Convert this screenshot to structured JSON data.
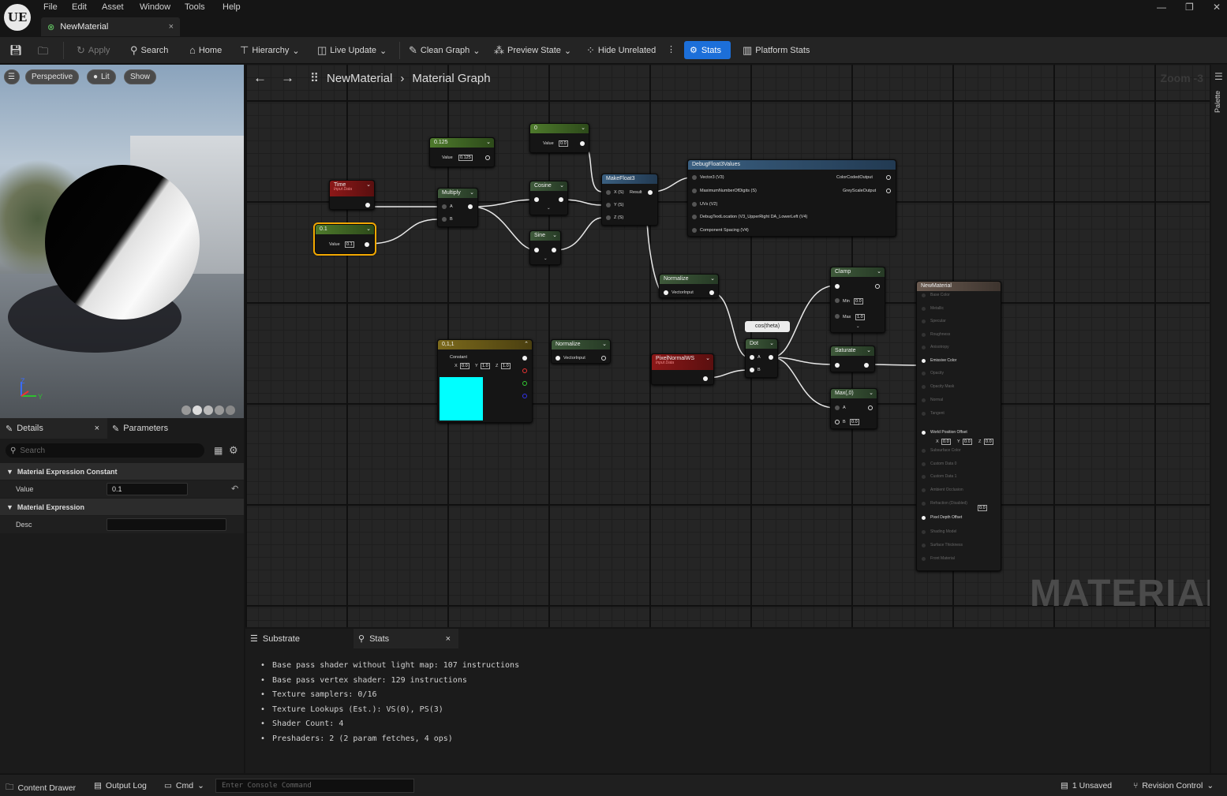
{
  "app": {
    "logo": "UE",
    "menu": [
      "File",
      "Edit",
      "Asset",
      "Window",
      "Tools",
      "Help"
    ],
    "tab_title": "NewMaterial"
  },
  "toolbar": {
    "apply": "Apply",
    "search": "Search",
    "home": "Home",
    "hierarchy": "Hierarchy",
    "live_update": "Live Update",
    "clean_graph": "Clean Graph",
    "preview_state": "Preview State",
    "hide_unrelated": "Hide Unrelated",
    "stats": "Stats",
    "platform_stats": "Platform Stats"
  },
  "viewport": {
    "perspective": "Perspective",
    "lit": "Lit",
    "show": "Show",
    "axis_z": "Z",
    "axis_y": "Y"
  },
  "details": {
    "tab_details": "Details",
    "tab_parameters": "Parameters",
    "search_placeholder": "Search",
    "cat1": "Material Expression Constant",
    "value_label": "Value",
    "value": "0.1",
    "cat2": "Material Expression",
    "desc_label": "Desc",
    "desc": ""
  },
  "graph": {
    "breadcrumb_root": "NewMaterial",
    "breadcrumb_leaf": "Material Graph",
    "zoom": "Zoom -3",
    "watermark": "MATERIAL",
    "nodes": {
      "const0": {
        "title": "0",
        "value_label": "Value",
        "value": "0.0"
      },
      "const0125": {
        "title": "0.125",
        "value_label": "Value",
        "value": "0.125"
      },
      "time": {
        "title": "Time",
        "sub": "Input Data"
      },
      "const01": {
        "title": "0.1",
        "value_label": "Value",
        "value": "0.1"
      },
      "multiply": {
        "title": "Multiply",
        "a": "A",
        "b": "B"
      },
      "cosine": {
        "title": "Cosine"
      },
      "sine": {
        "title": "Sine"
      },
      "makefloat3": {
        "title": "MakeFloat3",
        "x": "X (S)",
        "result": "Result",
        "y": "Y (S)",
        "z": "Z (S)"
      },
      "debug": {
        "title": "DebugFloat3Values",
        "in1": "Vector3 (V3)",
        "out1": "ColorCodedOutput",
        "in2": "MaximumNumberOfDigits (S)",
        "out2": "GreyScaleOutput",
        "in3": "UVs (V2)",
        "in4": "DebugTextLocation (V3_UpperRight DA_LowerLeft (V4)",
        "in5": "Component Spacing (V4)"
      },
      "normalize1": {
        "title": "Normalize",
        "pin": "VectorInput"
      },
      "clamp": {
        "title": "Clamp",
        "min_label": "Min",
        "min": "0.0",
        "max_label": "Max",
        "max": "1.0"
      },
      "comment": "cos(theta)",
      "constvec": {
        "title": "0,1,1",
        "sub": "Constant",
        "x": "0.0",
        "y": "1.0",
        "z": "1.0",
        "swatch": "#00ffff"
      },
      "normalize2": {
        "title": "Normalize",
        "pin": "VectorInput"
      },
      "pixelnormal": {
        "title": "PixelNormalWS",
        "sub": "Input Data"
      },
      "dot": {
        "title": "Dot",
        "a": "A",
        "b": "B"
      },
      "saturate": {
        "title": "Saturate"
      },
      "max": {
        "title": "Max(,0)",
        "a": "A",
        "b_label": "B",
        "b": "0.0"
      },
      "result": {
        "title": "NewMaterial",
        "pins": [
          "Base Color",
          "Metallic",
          "Specular",
          "Roughness",
          "Anisotropy",
          "Emissive Color",
          "Opacity",
          "Opacity Mask",
          "Normal",
          "Tangent",
          "World Position Offset",
          "Subsurface Color",
          "Custom Data 0",
          "Custom Data 1",
          "Ambient Occlusion",
          "Refraction (Disabled)",
          "Pixel Depth Offset",
          "Shading Model",
          "Surface Thickness",
          "Front Material"
        ],
        "wpo_x": "0.0",
        "wpo_y": "0.0",
        "wpo_z": "0.0",
        "pdo": "0.0"
      }
    }
  },
  "bottom": {
    "tab_substrate": "Substrate",
    "tab_stats": "Stats",
    "stats": [
      "Base pass shader without light map: 107 instructions",
      "Base pass vertex shader: 129 instructions",
      "Texture samplers: 0/16",
      "Texture Lookups (Est.): VS(0), PS(3)",
      "Shader Count: 4",
      "Preshaders: 2  (2 param fetches, 4 ops)"
    ]
  },
  "statusbar": {
    "content_drawer": "Content Drawer",
    "output_log": "Output Log",
    "cmd": "Cmd",
    "console_placeholder": "Enter Console Command",
    "unsaved": "1 Unsaved",
    "revision": "Revision Control"
  },
  "right_strip": {
    "palette": "Palette"
  }
}
